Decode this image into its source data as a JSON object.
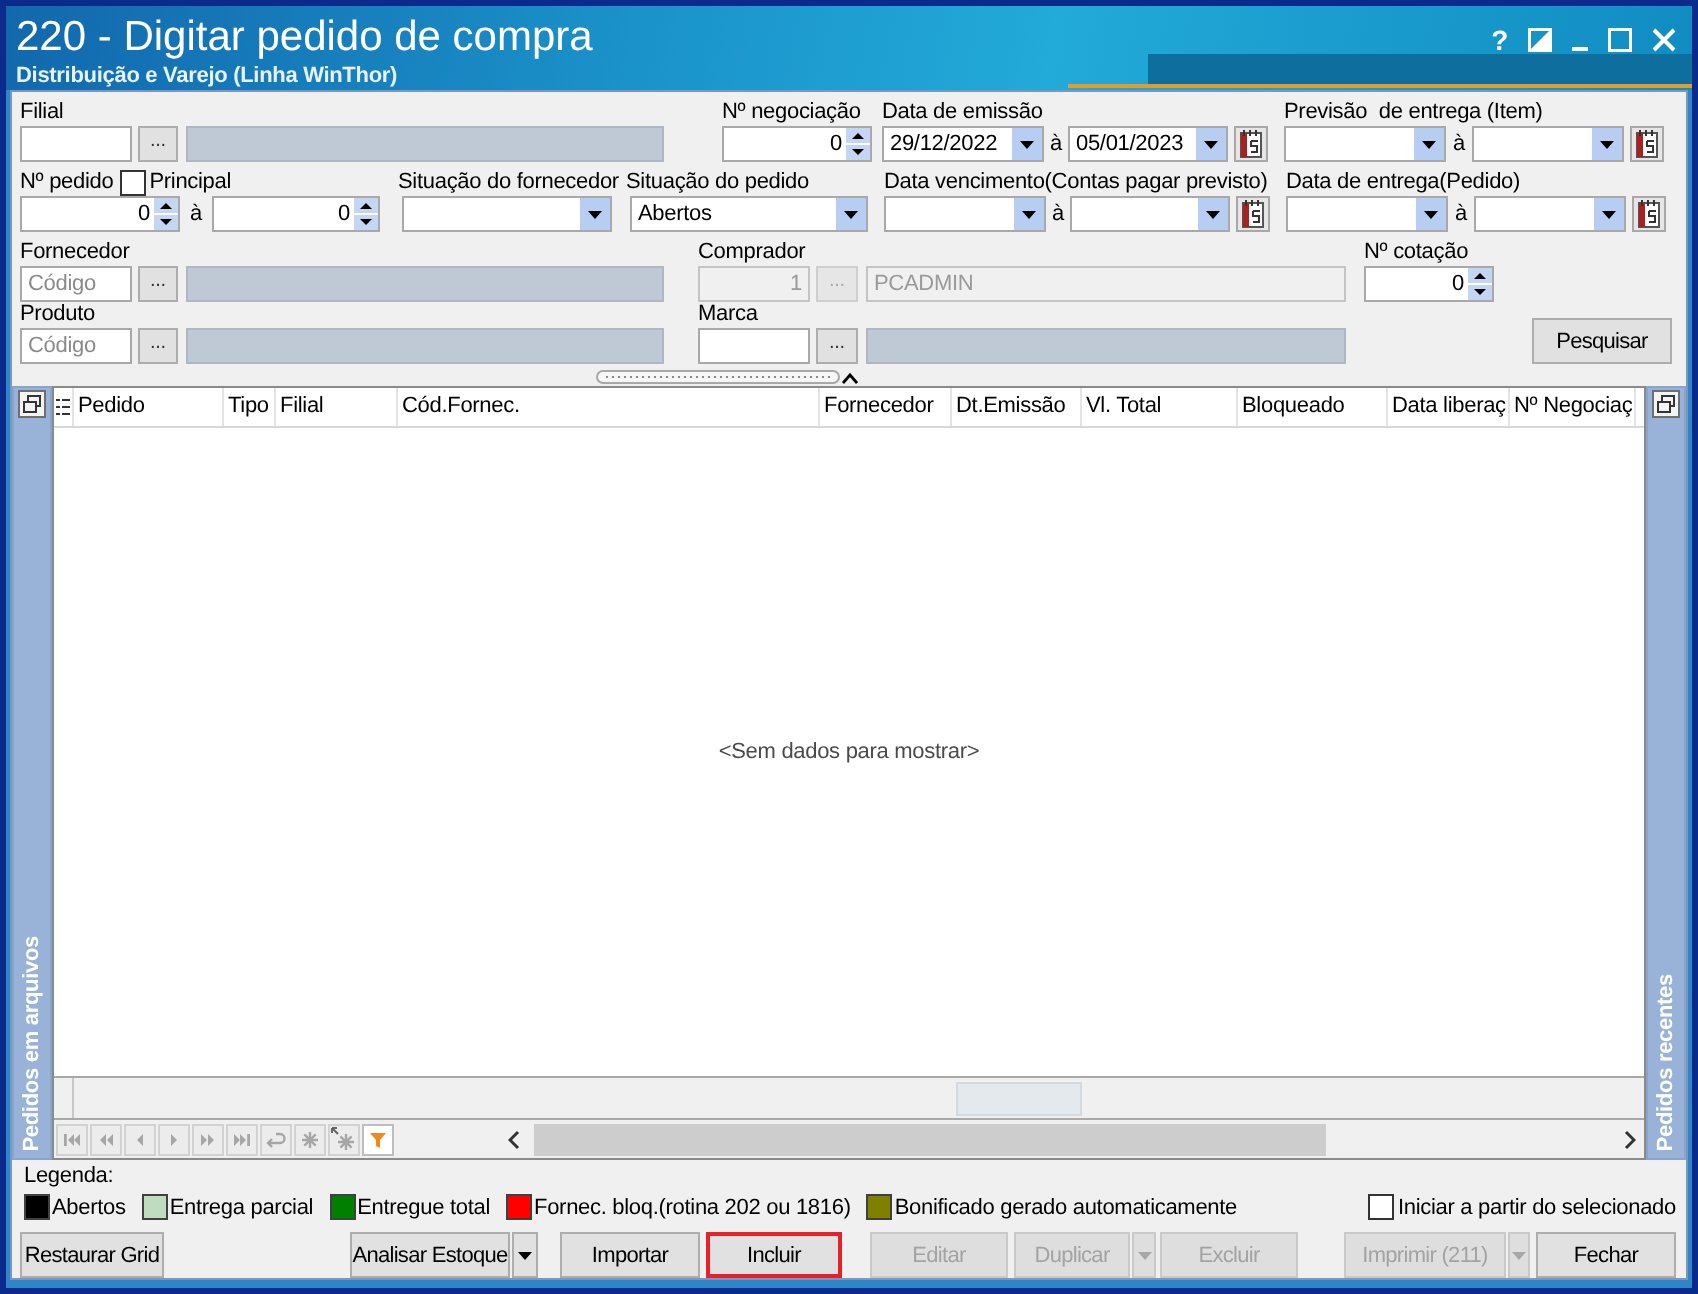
{
  "window": {
    "title": "220 - Digitar pedido de compra",
    "subtitle": "Distribuição e Varejo (Linha WinThor)",
    "help_button": "?"
  },
  "filters": {
    "filial": {
      "label": "Filial",
      "button": "...",
      "disabled": false
    },
    "negociacao": {
      "label": "Nº negociação",
      "value": "0"
    },
    "data_emissao": {
      "label": "Data de emissão",
      "from": "29/12/2022",
      "separator": "à",
      "to": "05/01/2023"
    },
    "previsao_entrega": {
      "label": "Previsão  de entrega (Item)",
      "separator": "à"
    },
    "pedido": {
      "label": "Nº pedido",
      "principal": {
        "label": "Principal",
        "checked": false
      },
      "from": "0",
      "separator": "à",
      "to": "0"
    },
    "situacao_fornecedor": {
      "label": "Situação do fornecedor"
    },
    "situacao_pedido": {
      "label": "Situação do pedido",
      "value": "Abertos"
    },
    "data_vencimento": {
      "label": "Data vencimento(Contas pagar previsto)",
      "separator": "à"
    },
    "data_entrega": {
      "label": "Data de entrega(Pedido)",
      "separator": "à"
    },
    "fornecedor": {
      "label": "Fornecedor",
      "placeholder": "Código",
      "button": "...",
      "disabled": false
    },
    "comprador": {
      "label": "Comprador",
      "code": "1",
      "button": "...",
      "description": "PCADMIN",
      "disabled": true
    },
    "cotacao": {
      "label": "Nº cotação",
      "value": "0"
    },
    "produto": {
      "label": "Produto",
      "placeholder": "Código",
      "button": "...",
      "disabled": false
    },
    "marca": {
      "label": "Marca",
      "button": "...",
      "disabled": false
    },
    "search_button": "Pesquisar"
  },
  "grid": {
    "left_panel": "Pedidos em arquivos",
    "columns": [
      "Pedido",
      "Tipo",
      "Filial",
      "Cód.Fornec.",
      "Fornecedor",
      "Dt.Emissão",
      "Vl. Total",
      "Bloqueado",
      "Data liberaç",
      "Nº Negociaç"
    ],
    "empty_text": "<Sem dados para mostrar>",
    "right_panel": "Pedidos recentes"
  },
  "legend": {
    "title": "Legenda:",
    "items": [
      {
        "label": "Abertos",
        "color": "#000000"
      },
      {
        "label": "Entrega parcial",
        "color": "#c0dcc0"
      },
      {
        "label": "Entregue total",
        "color": "#008000"
      },
      {
        "label": "Fornec. bloq.(rotina 202 ou 1816)",
        "color": "#ff0000"
      },
      {
        "label": "Bonificado gerado automaticamente",
        "color": "#808000"
      }
    ],
    "start_from_selected": {
      "label": "Iniciar a partir do selecionado",
      "checked": false
    }
  },
  "buttons": [
    {
      "label": "Restaurar Grid",
      "kind": "plain",
      "disabled": false,
      "highlighted": false
    },
    {
      "label": "Analisar Estoque",
      "kind": "split",
      "disabled": false,
      "highlighted": false
    },
    {
      "label": "Importar",
      "kind": "plain",
      "disabled": false,
      "highlighted": false
    },
    {
      "label": "Incluir",
      "kind": "plain",
      "disabled": false,
      "highlighted": true
    },
    {
      "label": "Editar",
      "kind": "plain",
      "disabled": true,
      "highlighted": false
    },
    {
      "label": "Duplicar",
      "kind": "split",
      "disabled": true,
      "highlighted": false
    },
    {
      "label": "Excluir",
      "kind": "plain",
      "disabled": true,
      "highlighted": false
    },
    {
      "label": "Imprimir (211)",
      "kind": "split",
      "disabled": true,
      "highlighted": false
    },
    {
      "label": "Fechar",
      "kind": "plain",
      "disabled": false,
      "highlighted": false
    }
  ]
}
